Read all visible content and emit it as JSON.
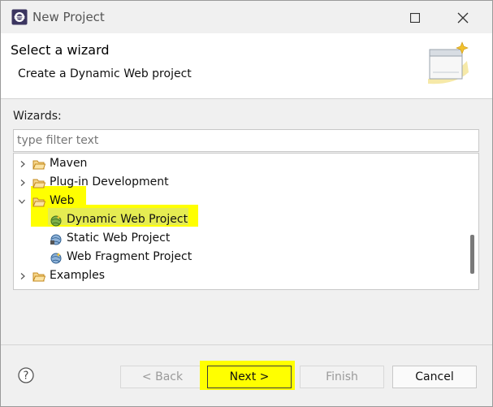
{
  "window": {
    "title": "New Project"
  },
  "header": {
    "title": "Select a wizard",
    "description": "Create a Dynamic Web project"
  },
  "wizards": {
    "label": "Wizards:",
    "filter_placeholder": "type filter text",
    "tree": {
      "maven": "Maven",
      "plugin_development": "Plug-in Development",
      "web": "Web",
      "dynamic_web_project": "Dynamic Web Project",
      "static_web_project": "Static Web Project",
      "web_fragment_project": "Web Fragment Project",
      "examples": "Examples"
    }
  },
  "buttons": {
    "back": "< Back",
    "next": "Next >",
    "finish": "Finish",
    "cancel": "Cancel"
  },
  "colors": {
    "highlight": "#ffff00",
    "selection": "#e5ec52",
    "folder": "#e8a93a"
  }
}
